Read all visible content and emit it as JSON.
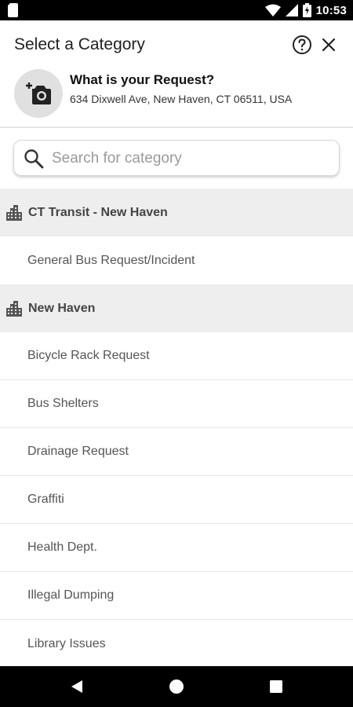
{
  "status_bar": {
    "time": "10:53",
    "icons": [
      "sim-card-icon",
      "wifi-icon",
      "cell-signal-icon",
      "battery-charging-icon"
    ]
  },
  "header": {
    "title": "Select a Category",
    "help_icon": "help-circle-icon",
    "close_icon": "close-icon"
  },
  "request": {
    "title": "What is your Request?",
    "address": "634 Dixwell Ave, New Haven, CT 06511, USA",
    "photo_icon": "add-photo-icon"
  },
  "search": {
    "placeholder": "Search for category",
    "value": "",
    "icon": "search-icon"
  },
  "groups": [
    {
      "label": "CT Transit - New Haven",
      "icon": "building-icon",
      "items": [
        "General Bus Request/Incident"
      ]
    },
    {
      "label": "New Haven",
      "icon": "building-icon",
      "items": [
        "Bicycle Rack Request",
        "Bus Shelters",
        "Drainage Request",
        "Graffiti",
        "Health Dept.",
        "Illegal Dumping",
        "Library Issues"
      ]
    }
  ],
  "nav_bar": {
    "buttons": [
      "back-icon",
      "home-icon",
      "recents-icon"
    ]
  },
  "colors": {
    "status_bar": "#000000",
    "group_header_bg": "#eeeeee",
    "avatar_bg": "#e0e0e0",
    "text_primary": "#212121",
    "text_secondary": "#555555"
  }
}
